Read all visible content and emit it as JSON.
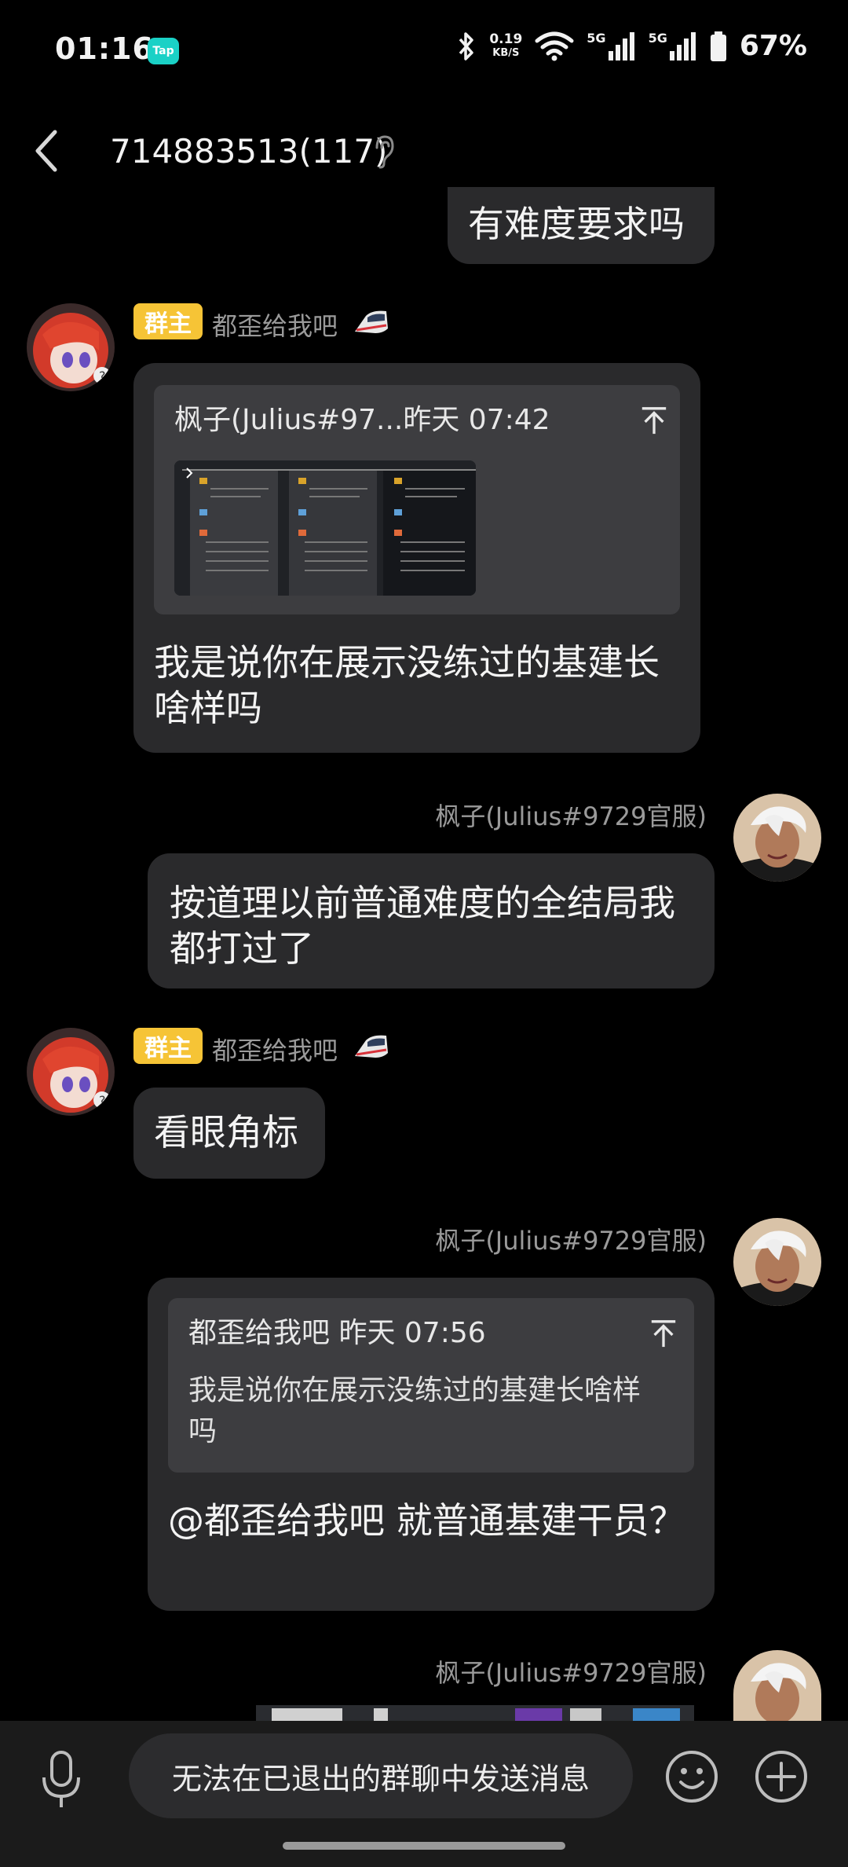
{
  "status_bar": {
    "time": "01:16",
    "app_badge": "Tap",
    "net_speed_value": "0.19",
    "net_speed_unit": "KB/S",
    "signal_tag_1": "5G",
    "signal_tag_2": "5G",
    "battery": "67%"
  },
  "header": {
    "title": "714883513(117)"
  },
  "messages": {
    "m0": {
      "text": "有难度要求吗"
    },
    "m1": {
      "badge": "群主",
      "sender": "都歪给我吧",
      "quote_header": "枫子(Julius#97...昨天 07:42",
      "text": "我是说你在展示没练过的基建长啥样吗"
    },
    "m2": {
      "sender": "枫子(Julius#9729官服)",
      "text": "按道理以前普通难度的全结局我都打过了"
    },
    "m3": {
      "badge": "群主",
      "sender": "都歪给我吧",
      "text": "看眼角标"
    },
    "m4": {
      "sender": "枫子(Julius#9729官服)",
      "quote_header": "都歪给我吧 昨天 07:56",
      "quote_text": "我是说你在展示没练过的基建长啥样吗",
      "text": "@都歪给我吧 就普通基建干员？"
    },
    "m5": {
      "sender": "枫子(Julius#9729官服)"
    }
  },
  "composer": {
    "disabled_text": "无法在已退出的群聊中发送消息"
  },
  "icons": {
    "back": "back-arrow-icon",
    "ear": "ear-icon",
    "train": "train-icon",
    "mic": "mic-icon",
    "emoji": "emoji-icon",
    "plus": "plus-icon",
    "jump": "jump-to-quote-icon"
  },
  "colors": {
    "background": "#000000",
    "bubble": "#2a2a2c",
    "quote": "#3d3d40",
    "owner_badge": "#f6c436",
    "tap_badge": "#1ad1c6"
  }
}
